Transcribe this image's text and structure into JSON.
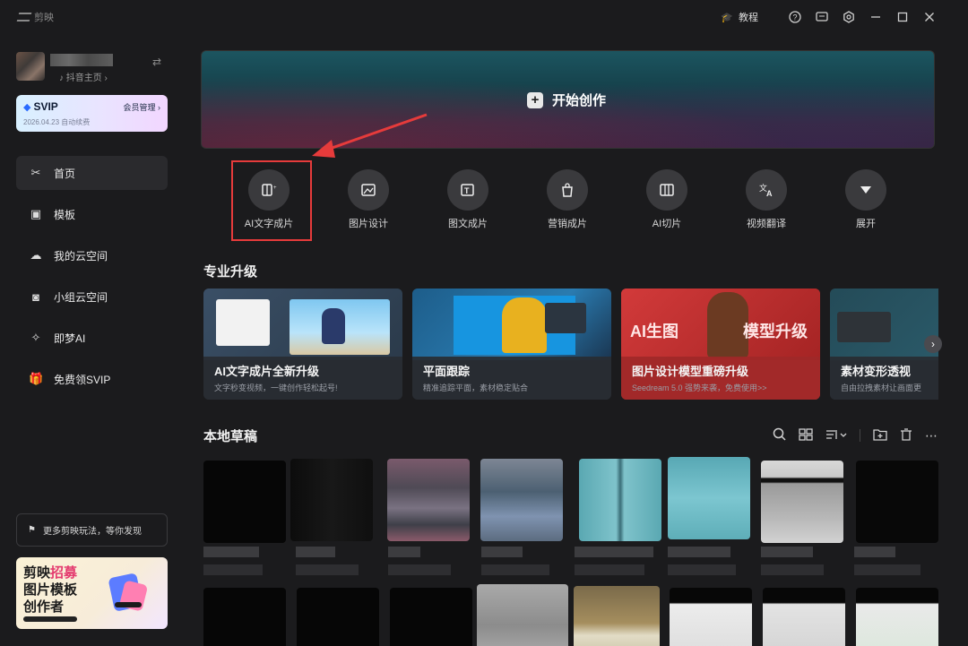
{
  "app": {
    "title": "剪映"
  },
  "titlebar": {
    "tutorial_label": "教程"
  },
  "profile": {
    "douyin_label": "抖音主页 ›"
  },
  "svip": {
    "label": "SVIP",
    "date": "2026.04.23 自动续费",
    "manage": "会员管理 ›"
  },
  "nav": [
    {
      "label": "首页",
      "icon": "scissors-icon"
    },
    {
      "label": "模板",
      "icon": "template-icon"
    },
    {
      "label": "我的云空间",
      "icon": "cloud-icon"
    },
    {
      "label": "小组云空间",
      "icon": "group-icon"
    },
    {
      "label": "即梦AI",
      "icon": "star-icon"
    },
    {
      "label": "免费领SVIP",
      "icon": "gift-icon"
    }
  ],
  "promo": {
    "label": "更多剪映玩法，等你发现"
  },
  "recruit": {
    "line1a": "剪映",
    "line1b": "招募",
    "line2": "图片模板",
    "line3": "创作者"
  },
  "hero": {
    "label": "开始创作"
  },
  "tools": [
    {
      "label": "AI文字成片",
      "icon": "ai-text-video-icon"
    },
    {
      "label": "图片设计",
      "icon": "image-design-icon"
    },
    {
      "label": "图文成片",
      "icon": "text-image-icon"
    },
    {
      "label": "营销成片",
      "icon": "marketing-icon"
    },
    {
      "label": "AI切片",
      "icon": "ai-slice-icon"
    },
    {
      "label": "视频翻译",
      "icon": "translate-icon"
    },
    {
      "label": "展开",
      "icon": "expand-icon"
    }
  ],
  "pro_section": {
    "title": "专业升级"
  },
  "cards": [
    {
      "title": "AI文字成片全新升级",
      "sub": "文字秒变视频，一键创作轻松起号!"
    },
    {
      "title": "平面跟踪",
      "sub": "精准追踪平面，素材稳定贴合"
    },
    {
      "title": "图片设计模型重磅升级",
      "sub": "Seedream 5.0 强势来袭，免费使用>>",
      "badge_left": "AI生图",
      "badge_right": "模型升级"
    },
    {
      "title": "素材变形透视",
      "sub": "自由拉拽素材让画面更"
    }
  ],
  "drafts_section": {
    "title": "本地草稿"
  }
}
